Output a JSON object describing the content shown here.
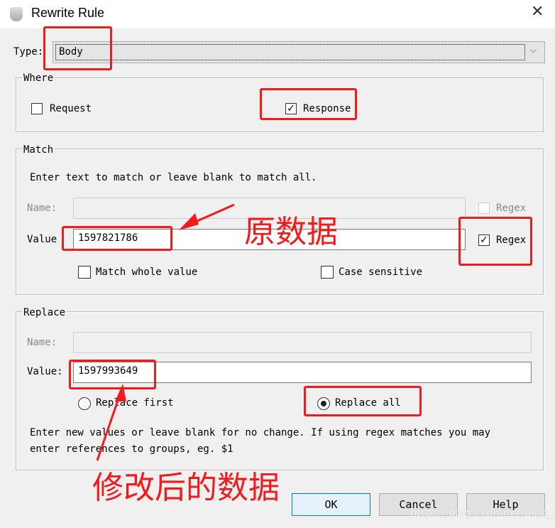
{
  "window": {
    "title": "Rewrite Rule",
    "close_icon": "close-icon"
  },
  "type": {
    "label": "Type:",
    "value": "Body"
  },
  "where": {
    "legend": "Where",
    "request": {
      "label": "Request",
      "checked": false
    },
    "response": {
      "label": "Response",
      "checked": true
    }
  },
  "match": {
    "legend": "Match",
    "hint": "Enter text to match or leave blank to match all.",
    "name_label": "Name:",
    "name_value": "",
    "name_regex": {
      "label": "Regex",
      "checked": false
    },
    "value_label": "Value",
    "value": "1597821786",
    "value_regex": {
      "label": "Regex",
      "checked": true
    },
    "whole_value": {
      "label": "Match whole value",
      "checked": false
    },
    "case_sensitive": {
      "label": "Case sensitive",
      "checked": false
    }
  },
  "replace": {
    "legend": "Replace",
    "name_label": "Name:",
    "name_value": "",
    "value_label": "Value:",
    "value": "1597993649",
    "replace_first": {
      "label": "Replace first",
      "selected": false
    },
    "replace_all": {
      "label": "Replace all",
      "selected": true
    },
    "hint1": "Enter new values or leave blank for no change. If using regex matches you may",
    "hint2": "enter references to groups, eg. $1"
  },
  "buttons": {
    "ok": "OK",
    "cancel": "Cancel",
    "help": "Help"
  },
  "annotations": {
    "original": "原数据",
    "modified": "修改后的数据",
    "highlight_color": "#f21a1a"
  },
  "watermark": "https://blog.csdn.net/blue__lll"
}
